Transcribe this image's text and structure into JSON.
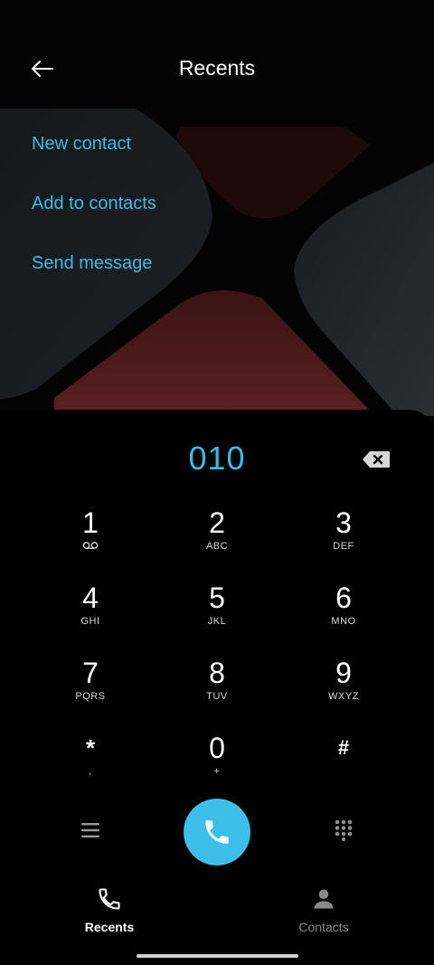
{
  "header": {
    "title": "Recents"
  },
  "actions": [
    {
      "label": "New contact"
    },
    {
      "label": "Add to contacts"
    },
    {
      "label": "Send message"
    }
  ],
  "dialer": {
    "number": "010"
  },
  "keypad": [
    {
      "digit": "1",
      "letters": ""
    },
    {
      "digit": "2",
      "letters": "ABC"
    },
    {
      "digit": "3",
      "letters": "DEF"
    },
    {
      "digit": "4",
      "letters": "GHI"
    },
    {
      "digit": "5",
      "letters": "JKL"
    },
    {
      "digit": "6",
      "letters": "MNO"
    },
    {
      "digit": "7",
      "letters": "PQRS"
    },
    {
      "digit": "8",
      "letters": "TUV"
    },
    {
      "digit": "9",
      "letters": "WXYZ"
    },
    {
      "digit": "*",
      "letters": ","
    },
    {
      "digit": "0",
      "letters": "+"
    },
    {
      "digit": "#",
      "letters": ""
    }
  ],
  "tabs": [
    {
      "label": "Recents",
      "icon": "phone-icon",
      "active": true
    },
    {
      "label": "Contacts",
      "icon": "person-icon",
      "active": false
    }
  ],
  "colors": {
    "accent": "#3dbbe6",
    "call_button": "#3cbfe8",
    "background": "#000000",
    "inactive_tab": "#8a8a8a"
  },
  "icons": {
    "back": "arrow-left-icon",
    "backspace": "backspace-icon",
    "voicemail": "voicemail-icon",
    "menu": "menu-icon",
    "dialpad": "dialpad-icon",
    "call": "phone-icon"
  }
}
